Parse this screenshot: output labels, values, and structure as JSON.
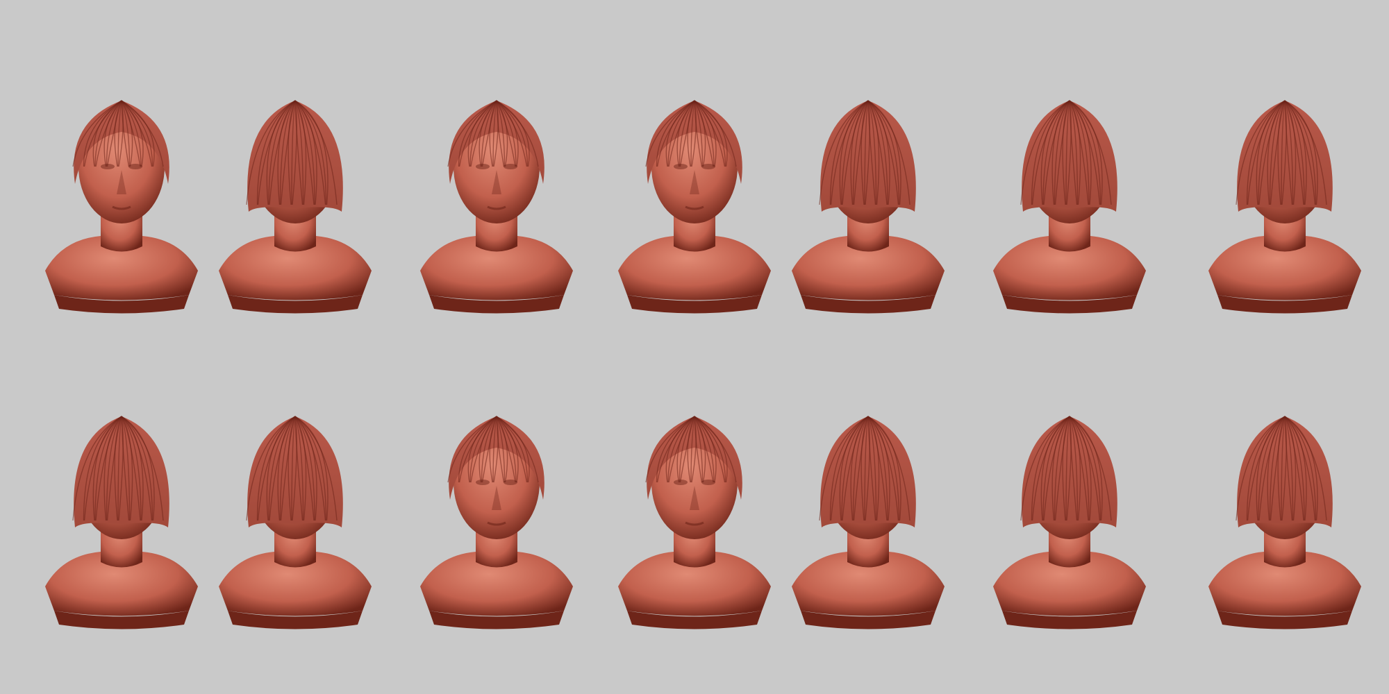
{
  "scene": {
    "background_color": "#c9c9c9",
    "material_color": "#c2604d",
    "hair_color": "#a2493a",
    "shadow_color": "#6e2519"
  },
  "busts": [
    {
      "row": 1,
      "view": "front-bust"
    },
    {
      "row": 1,
      "view": "back-three-quarter-low"
    },
    {
      "row": 1,
      "view": "front"
    },
    {
      "row": 1,
      "view": "front"
    },
    {
      "row": 1,
      "view": "right-profile"
    },
    {
      "row": 1,
      "view": "left-three-quarter"
    },
    {
      "row": 1,
      "view": "back-right-three-quarter"
    },
    {
      "row": 2,
      "view": "back-left-three-quarter"
    },
    {
      "row": 2,
      "view": "back"
    },
    {
      "row": 2,
      "view": "front-low"
    },
    {
      "row": 2,
      "view": "front-tilted-down"
    },
    {
      "row": 2,
      "view": "right-three-quarter"
    },
    {
      "row": 2,
      "view": "left-back-three-quarter"
    },
    {
      "row": 2,
      "view": "left-profile"
    }
  ]
}
